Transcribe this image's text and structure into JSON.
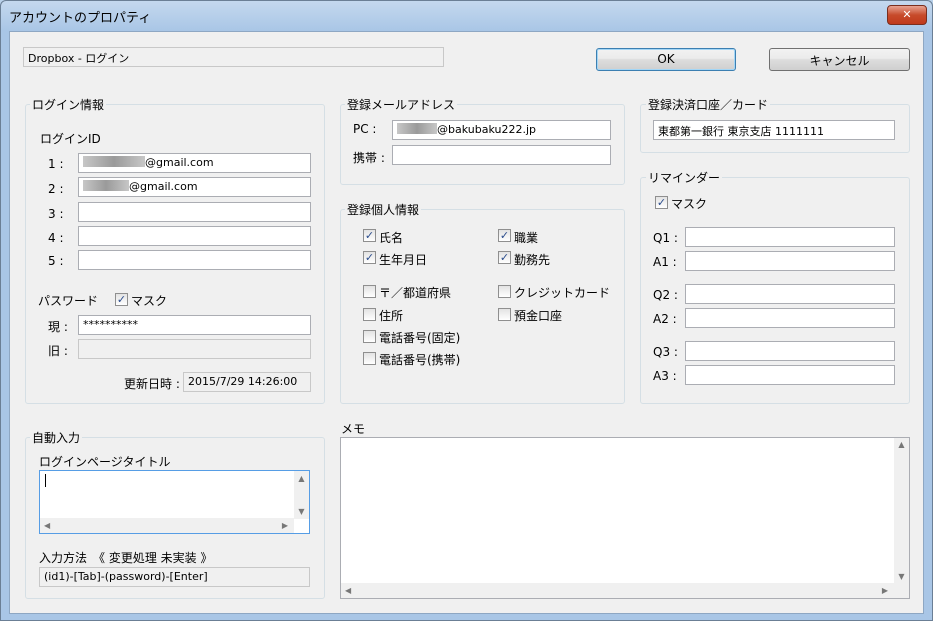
{
  "window": {
    "title": "アカウントのプロパティ",
    "close_glyph": "✕"
  },
  "header": {
    "account_name": "Dropbox - ログイン",
    "ok_label": "OK",
    "cancel_label": "キャンセル"
  },
  "login": {
    "legend": "ログイン情報",
    "id_label": "ログインID",
    "ids": [
      {
        "label": "1 :",
        "value": "@gmail.com"
      },
      {
        "label": "2 :",
        "value": "@gmail.com"
      },
      {
        "label": "3 :",
        "value": ""
      },
      {
        "label": "4 :",
        "value": ""
      },
      {
        "label": "5 :",
        "value": ""
      }
    ],
    "password_label": "パスワード",
    "mask_label": "マスク",
    "mask_checked": "✓",
    "current_label": "現 :",
    "current_value": "**********",
    "old_label": "旧 :",
    "old_value": "",
    "updated_label": "更新日時 :",
    "updated_value": "2015/7/29  14:26:00"
  },
  "email": {
    "legend": "登録メールアドレス",
    "pc_label": "PC :",
    "pc_value": "@bakubaku222.jp",
    "mobile_label": "携帯 :",
    "mobile_value": ""
  },
  "personal": {
    "legend": "登録個人情報",
    "items": [
      {
        "label": "氏名",
        "check": "✓"
      },
      {
        "label": "職業",
        "check": "✓"
      },
      {
        "label": "生年月日",
        "check": "✓"
      },
      {
        "label": "勤務先",
        "check": "✓"
      },
      {
        "label": "〒／都道府県",
        "check": ""
      },
      {
        "label": "クレジットカード",
        "check": ""
      },
      {
        "label": "住所",
        "check": ""
      },
      {
        "label": "預金口座",
        "check": ""
      },
      {
        "label": "電話番号(固定)",
        "check": ""
      },
      {
        "label": "電話番号(携帯)",
        "check": ""
      }
    ]
  },
  "payment": {
    "legend": "登録決済口座／カード",
    "value": "東都第一銀行 東京支店 1111111"
  },
  "reminder": {
    "legend": "リマインダー",
    "mask_label": "マスク",
    "mask_checked": "✓",
    "rows": [
      {
        "label": "Q1 :",
        "value": ""
      },
      {
        "label": "A1 :",
        "value": ""
      },
      {
        "label": "Q2 :",
        "value": ""
      },
      {
        "label": "A2 :",
        "value": ""
      },
      {
        "label": "Q3 :",
        "value": ""
      },
      {
        "label": "A3 :",
        "value": ""
      }
    ]
  },
  "autofill": {
    "legend": "自動入力",
    "page_title_label": "ログインページタイトル",
    "page_title_value": "",
    "method_label": "入力方法　《 変更処理 未実装 》",
    "method_value": "(id1)-[Tab]-(password)-[Enter]"
  },
  "memo": {
    "label": "メモ",
    "value": ""
  },
  "scroll": {
    "up": "▲",
    "down": "▼",
    "left": "◀",
    "right": "▶"
  }
}
